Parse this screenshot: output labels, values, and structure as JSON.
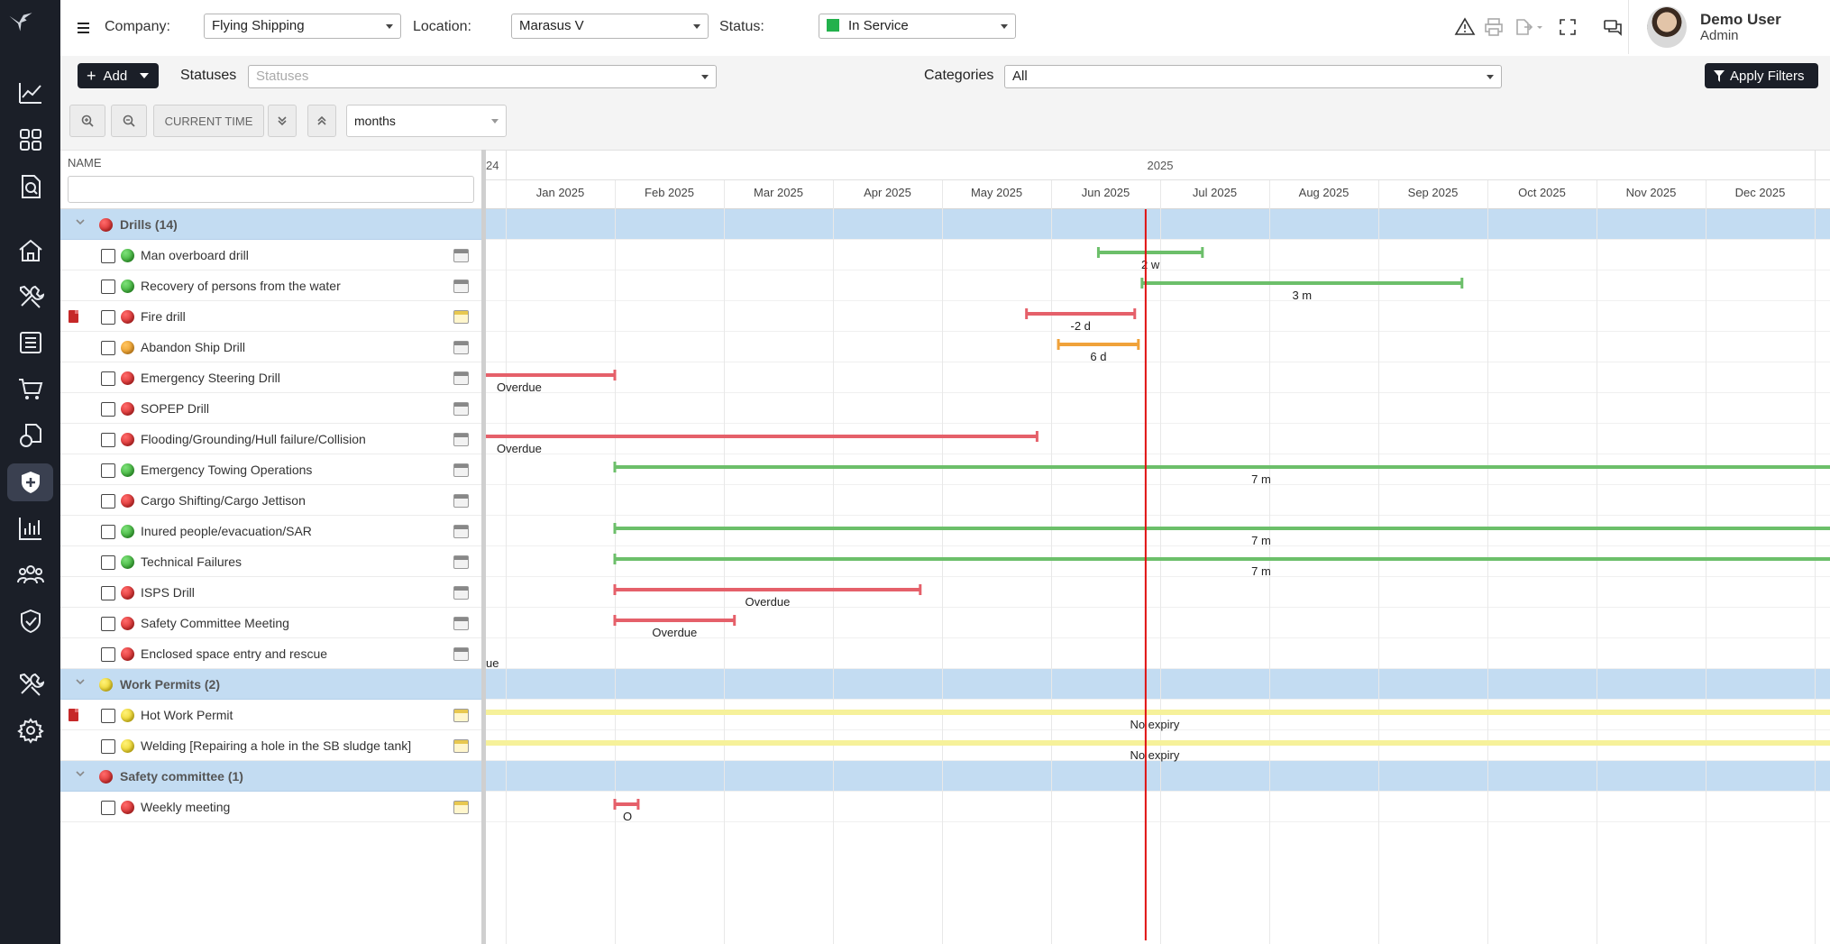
{
  "topbar": {
    "company_label": "Company:",
    "company_value": "Flying Shipping",
    "location_label": "Location:",
    "location_value": "Marasus V",
    "status_label": "Status:",
    "status_value": "In Service",
    "status_color": "#22b14c",
    "icons": [
      "warning-icon",
      "print-icon",
      "export-icon",
      "fullscreen-icon",
      "chat-icon",
      "info-icon"
    ]
  },
  "user": {
    "name": "Demo User",
    "role": "Admin"
  },
  "filters": {
    "add_label": "Add",
    "statuses_label": "Statuses",
    "statuses_placeholder": "Statuses",
    "categories_label": "Categories",
    "categories_value": "All",
    "apply_label": "Apply Filters"
  },
  "toolbar": {
    "current_time_label": "CURRENT TIME",
    "scale_value": "months"
  },
  "sidebar": {
    "items": [
      "logo",
      "chart-icon",
      "dashboard-icon",
      "search-document-icon",
      "home-icon",
      "tools-icon",
      "checklist-icon",
      "cart-icon",
      "documents-icon",
      "safety-shield-icon",
      "reports-icon",
      "crew-icon",
      "certificates-icon",
      "maintenance-icon",
      "settings-icon"
    ],
    "active": "safety-shield-icon"
  },
  "grid": {
    "header": "NAME",
    "rows": [
      {
        "type": "group",
        "label": "Drills (14)",
        "status": "red"
      },
      {
        "type": "task",
        "label": "Man overboard drill",
        "status": "green",
        "pdf": false,
        "cal": "grey"
      },
      {
        "type": "task",
        "label": "Recovery of persons from the water",
        "status": "green",
        "pdf": false,
        "cal": "grey"
      },
      {
        "type": "task",
        "label": "Fire drill",
        "status": "red",
        "pdf": true,
        "cal": "yellow"
      },
      {
        "type": "task",
        "label": "Abandon Ship Drill",
        "status": "orange",
        "pdf": false,
        "cal": "grey"
      },
      {
        "type": "task",
        "label": "Emergency Steering Drill",
        "status": "red",
        "pdf": false,
        "cal": "grey"
      },
      {
        "type": "task",
        "label": "SOPEP Drill",
        "status": "red",
        "pdf": false,
        "cal": "grey"
      },
      {
        "type": "task",
        "label": "Flooding/Grounding/Hull failure/Collision",
        "status": "red",
        "pdf": false,
        "cal": "grey"
      },
      {
        "type": "task",
        "label": "Emergency Towing Operations",
        "status": "green",
        "pdf": false,
        "cal": "grey"
      },
      {
        "type": "task",
        "label": "Cargo Shifting/Cargo Jettison",
        "status": "red",
        "pdf": false,
        "cal": "grey"
      },
      {
        "type": "task",
        "label": "Inured people/evacuation/SAR",
        "status": "green",
        "pdf": false,
        "cal": "grey"
      },
      {
        "type": "task",
        "label": "Technical Failures",
        "status": "green",
        "pdf": false,
        "cal": "grey"
      },
      {
        "type": "task",
        "label": "ISPS Drill",
        "status": "red",
        "pdf": false,
        "cal": "grey"
      },
      {
        "type": "task",
        "label": "Safety Committee Meeting",
        "status": "red",
        "pdf": false,
        "cal": "grey"
      },
      {
        "type": "task",
        "label": "Enclosed space entry and rescue",
        "status": "red",
        "pdf": false,
        "cal": "grey"
      },
      {
        "type": "group",
        "label": "Work Permits (2)",
        "status": "yellow"
      },
      {
        "type": "task",
        "label": "Hot Work Permit",
        "status": "yellow",
        "pdf": true,
        "cal": "yellow"
      },
      {
        "type": "task",
        "label": "Welding [Repairing a hole in the SB sludge tank]",
        "status": "yellow",
        "pdf": false,
        "cal": "yellow"
      },
      {
        "type": "group",
        "label": "Safety committee (1)",
        "status": "red"
      },
      {
        "type": "task",
        "label": "Weekly meeting",
        "status": "red",
        "pdf": false,
        "cal": "yellow"
      }
    ]
  },
  "timeline": {
    "prev_year_fragment": "24",
    "year": "2025",
    "months": [
      "Jan 2025",
      "Feb 2025",
      "Mar 2025",
      "Apr 2025",
      "May 2025",
      "Jun 2025",
      "Jul 2025",
      "Aug 2025",
      "Sep 2025",
      "Oct 2025",
      "Nov 2025",
      "Dec 2025"
    ],
    "current_time": "2025-06-27",
    "bars": [
      {
        "row": 1,
        "start": "2025-06-14",
        "end": "2025-07-13",
        "color": "green",
        "label": "2 w"
      },
      {
        "row": 2,
        "start": "2025-06-26",
        "end": "2025-09-24",
        "color": "green",
        "label": "3 m"
      },
      {
        "row": 3,
        "start": "2025-05-25",
        "end": "2025-06-24",
        "color": "red",
        "label": "-2 d"
      },
      {
        "row": 4,
        "start": "2025-06-03",
        "end": "2025-06-25",
        "color": "orange",
        "label": "6 d"
      },
      {
        "row": 5,
        "start": null,
        "end": "2025-02-01",
        "color": "red",
        "label": "Overdue",
        "label_left": true
      },
      {
        "row": 7,
        "start": null,
        "end": "2025-05-28",
        "color": "red",
        "label": "Overdue",
        "label_left": true
      },
      {
        "row": 8,
        "start": "2025-02-01",
        "end": null,
        "color": "green",
        "label": "7 m"
      },
      {
        "row": 10,
        "start": "2025-02-01",
        "end": null,
        "color": "green",
        "label": "7 m"
      },
      {
        "row": 11,
        "start": "2025-02-01",
        "end": null,
        "color": "green",
        "label": "7 m"
      },
      {
        "row": 12,
        "start": "2025-02-01",
        "end": "2025-04-25",
        "color": "red",
        "label": "Overdue"
      },
      {
        "row": 13,
        "start": "2025-02-01",
        "end": "2025-03-04",
        "color": "red",
        "label": "Overdue"
      },
      {
        "row": 14,
        "start": null,
        "end": "2024-12-05",
        "color": "red",
        "label": "ue",
        "label_left": true
      },
      {
        "row": 16,
        "start": null,
        "end": null,
        "color": "yellow",
        "label": "No expiry"
      },
      {
        "row": 17,
        "start": null,
        "end": null,
        "color": "yellow",
        "label": "No expiry"
      },
      {
        "row": 19,
        "start": "2025-02-01",
        "end": "2025-02-07",
        "color": "red",
        "label": "O"
      }
    ],
    "colors": {
      "red": "#e5606a",
      "green": "#6cbf6a",
      "orange": "#f0a23a",
      "yellow": "#f6f19a",
      "now": "#e01010",
      "group": "#c3dcf2"
    }
  }
}
